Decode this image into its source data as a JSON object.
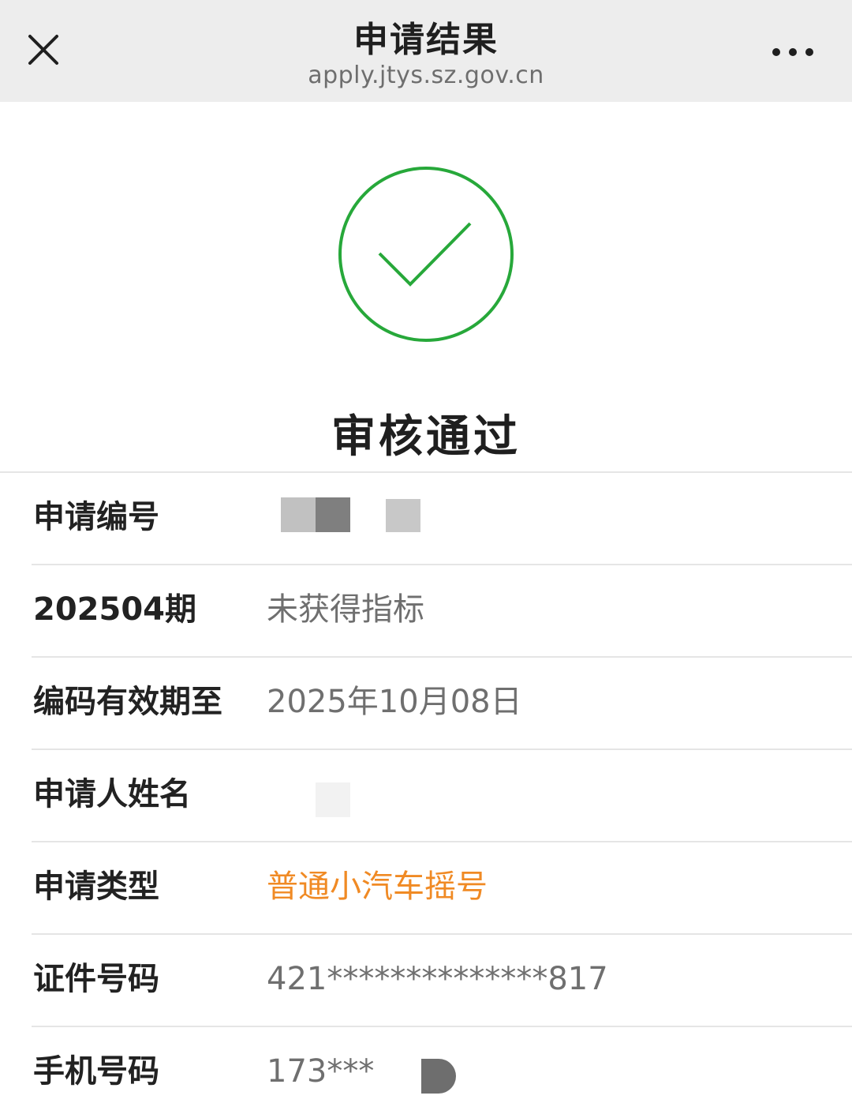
{
  "header": {
    "title": "申请结果",
    "domain": "apply.jtys.sz.gov.cn",
    "close_icon": "close-icon",
    "more_icon": "more-horizontal-icon"
  },
  "status": {
    "icon": "check-circle-icon",
    "text": "审核通过",
    "color": "#27a83a"
  },
  "details": [
    {
      "label": "申请编号",
      "value": ""
    },
    {
      "label": "202504期",
      "value": "未获得指标"
    },
    {
      "label": "编码有效期至",
      "value": "2025年10月08日"
    },
    {
      "label": "申请人姓名",
      "value": ""
    },
    {
      "label": "申请类型",
      "value": "普通小汽车摇号"
    },
    {
      "label": "证件号码",
      "value": "421**************817"
    },
    {
      "label": "手机号码",
      "value": "173***"
    }
  ],
  "colors": {
    "accent": "#f08a24",
    "label": "#222222",
    "value": "#6f6f6f",
    "topbar_bg": "#ededed"
  }
}
